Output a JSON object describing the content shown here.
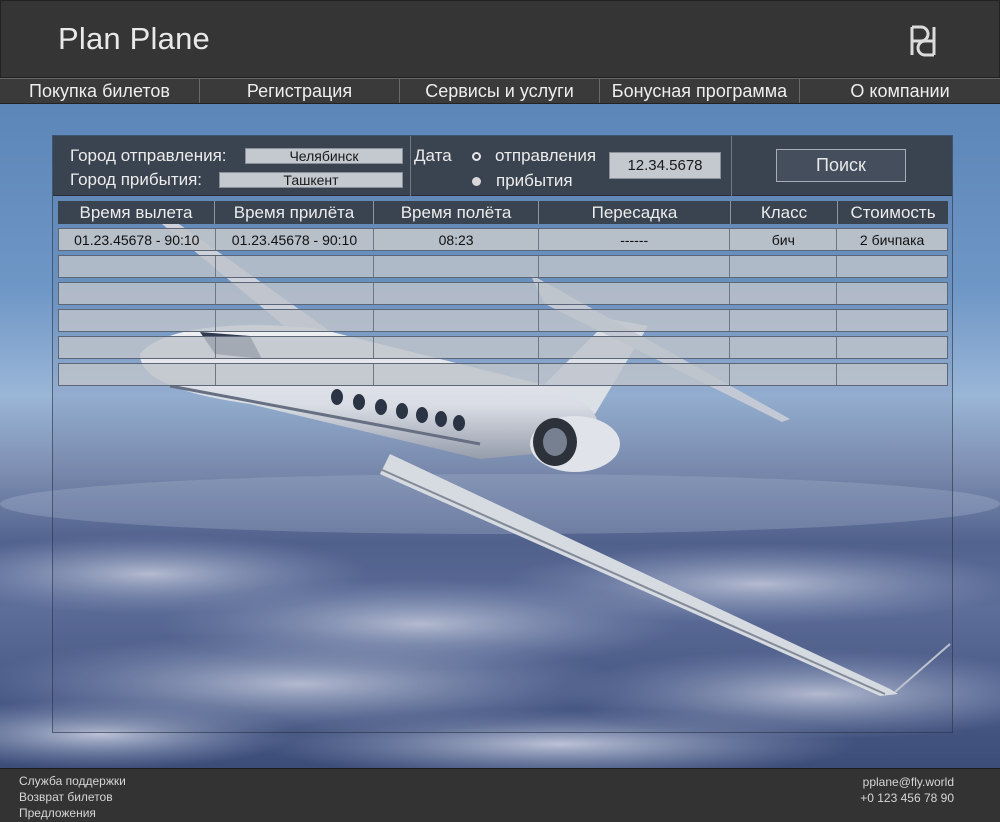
{
  "header": {
    "brand": "Plan Plane",
    "logo_icon": "pd-monogram-icon"
  },
  "nav": [
    {
      "label": "Покупка билетов"
    },
    {
      "label": "Регистрация"
    },
    {
      "label": "Сервисы и услуги"
    },
    {
      "label": "Бонусная программа"
    },
    {
      "label": "О компании"
    }
  ],
  "search": {
    "from_label": "Город отправления:",
    "from_value": "Челябинск",
    "to_label": "Город прибытия:",
    "to_value": "Ташкент",
    "date_label": "Дата",
    "radio_departure": "отправления",
    "radio_arrival": "прибытия",
    "date_value": "12.34.5678",
    "button": "Поиск"
  },
  "table": {
    "headers": [
      "Время вылета",
      "Время прилёта",
      "Время полёта",
      "Пересадка",
      "Класс",
      "Стоимость"
    ],
    "rows": [
      [
        "01.23.45678 - 90:10",
        "01.23.45678 - 90:10",
        "08:23",
        "------",
        "бич",
        "2 бичпака"
      ]
    ],
    "empty_rows": 5
  },
  "footer": {
    "links": [
      "Служба поддержки",
      "Возврат билетов",
      "Предложения"
    ],
    "email": "pplane@fly.world",
    "phone": "+0 123 456 78 90"
  },
  "colors": {
    "header_bg": "#353535",
    "panel_bg": "#3a4350",
    "cell_bg": "#bec3ca"
  }
}
